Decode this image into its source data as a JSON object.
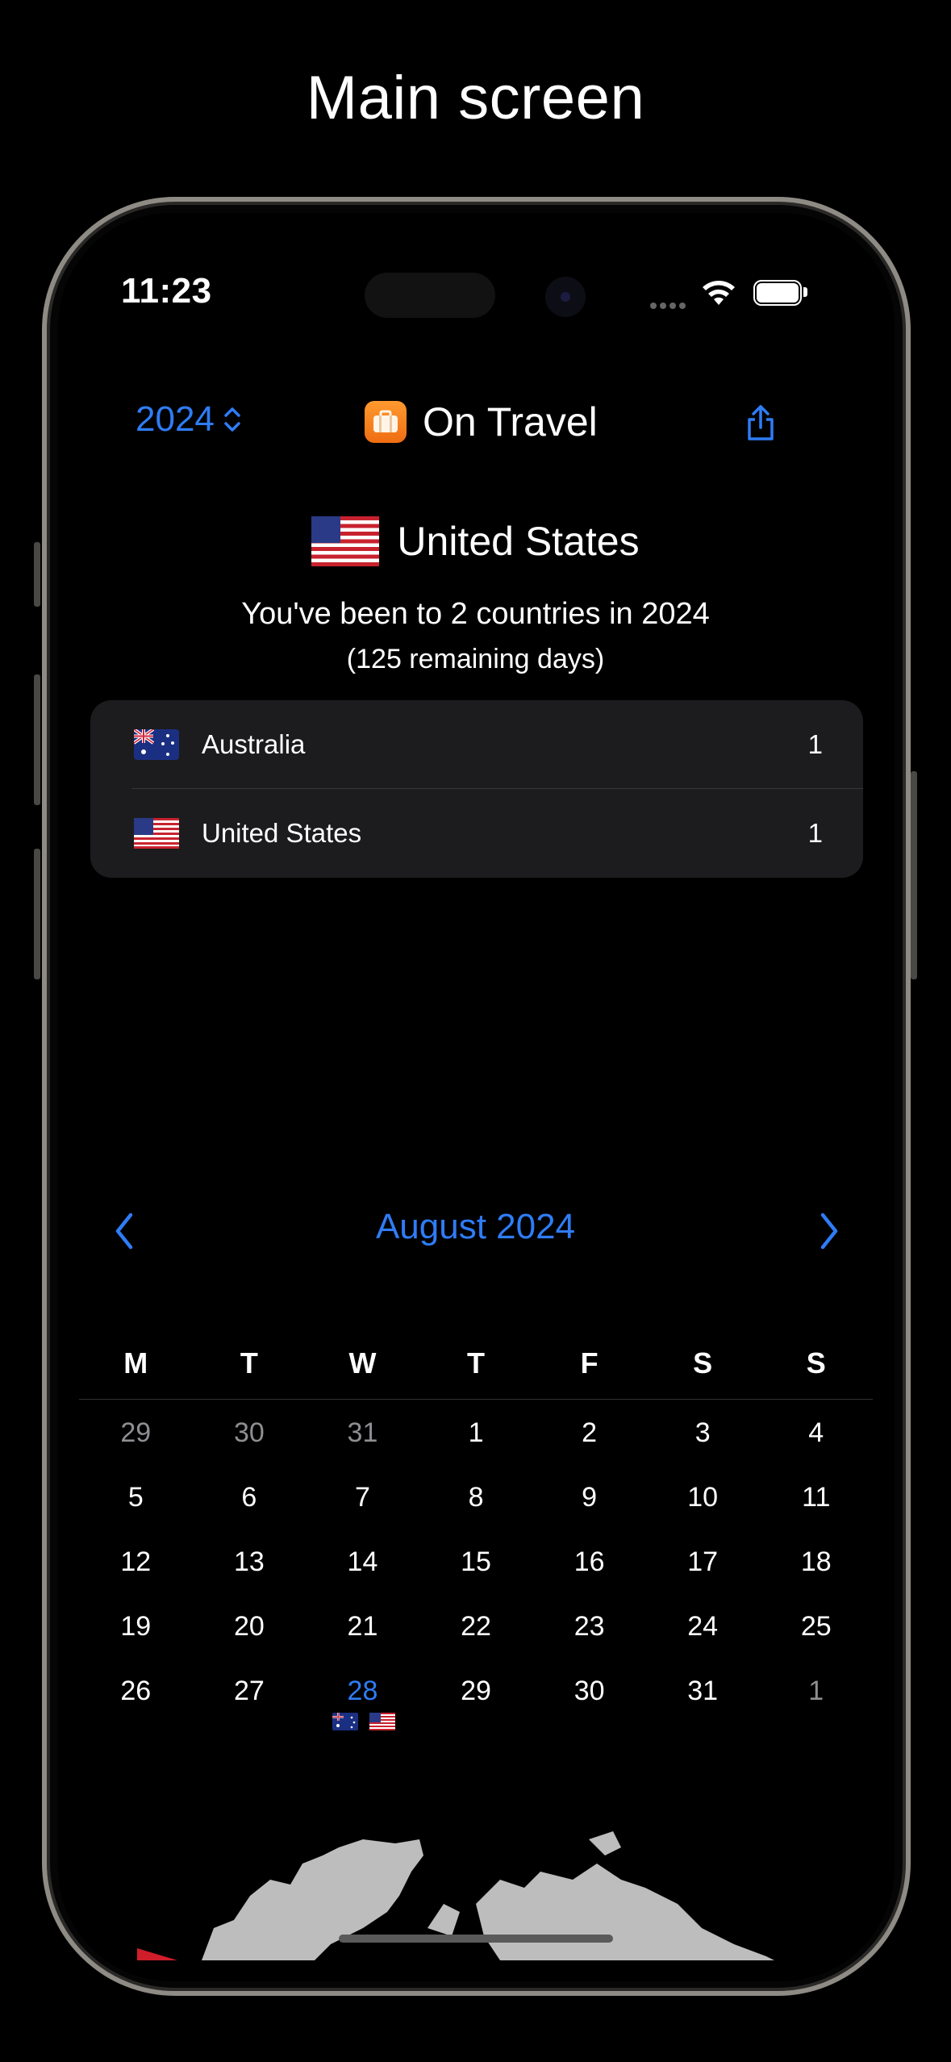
{
  "headline": "Main screen",
  "status": {
    "time": "11:23"
  },
  "nav": {
    "year": "2024",
    "app_title": "On Travel"
  },
  "current_country": {
    "name": "United States"
  },
  "summary": {
    "text": "You've been to 2 countries in 2024",
    "remaining": "(125 remaining days)"
  },
  "countries": [
    {
      "name": "Australia",
      "count": "1"
    },
    {
      "name": "United States",
      "count": "1"
    }
  ],
  "calendar": {
    "month_title": "August 2024",
    "weekdays": [
      "M",
      "T",
      "W",
      "T",
      "F",
      "S",
      "S"
    ],
    "weeks": [
      [
        "29",
        "30",
        "31",
        "1",
        "2",
        "3",
        "4"
      ],
      [
        "5",
        "6",
        "7",
        "8",
        "9",
        "10",
        "11"
      ],
      [
        "12",
        "13",
        "14",
        "15",
        "16",
        "17",
        "18"
      ],
      [
        "19",
        "20",
        "21",
        "22",
        "23",
        "24",
        "25"
      ],
      [
        "26",
        "27",
        "28",
        "29",
        "30",
        "31",
        "1"
      ]
    ]
  },
  "colors": {
    "accent": "#2f7cf6",
    "background": "#000000",
    "list_bg": "#1c1c1e"
  },
  "icons": [
    "chevron-updown-icon",
    "suitcase-app-icon",
    "share-icon",
    "chevron-left-icon",
    "chevron-right-icon",
    "wifi-icon",
    "battery-icon"
  ]
}
